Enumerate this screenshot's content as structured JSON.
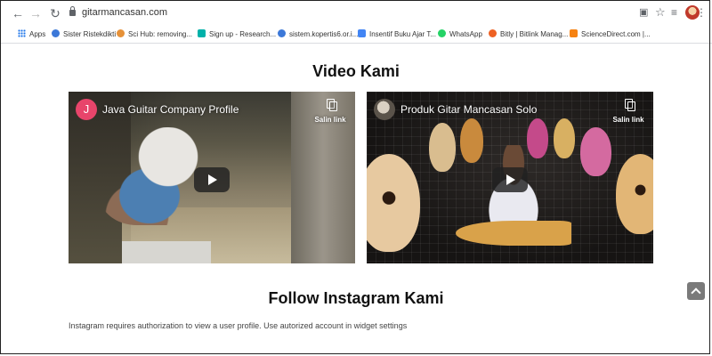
{
  "browser": {
    "url": "gitarmancasan.com",
    "icons": [
      "back-icon",
      "forward-icon",
      "reload-icon",
      "lock-icon",
      "star-icon",
      "kebab-icon"
    ]
  },
  "bookmarks": [
    {
      "label": "Apps",
      "icon": "apps-icon",
      "color": "#1a73e8"
    },
    {
      "label": "Sister Ristekdikti",
      "icon": "globe-icon",
      "color": "#3c78d8"
    },
    {
      "label": "Sci Hub: removing...",
      "icon": "scihub-icon",
      "color": "#e69138"
    },
    {
      "label": "Sign up - Research...",
      "icon": "researchgate-icon",
      "color": "#00b1a9"
    },
    {
      "label": "sistem.kopertis6.or.i...",
      "icon": "globe-icon",
      "color": "#3c78d8"
    },
    {
      "label": "Insentif Buku Ajar T...",
      "icon": "doc-icon",
      "color": "#4285f4"
    },
    {
      "label": "WhatsApp",
      "icon": "whatsapp-icon",
      "color": "#25d366"
    },
    {
      "label": "Bitly | Bitlink Manag...",
      "icon": "bitly-icon",
      "color": "#ee6123"
    },
    {
      "label": "ScienceDirect.com |...",
      "icon": "elsevier-icon",
      "color": "#f68212"
    }
  ],
  "video_section": {
    "title": "Video Kami",
    "videos": [
      {
        "avatar_letter": "J",
        "title": "Java Guitar Company Profile",
        "copy_label": "Salin link"
      },
      {
        "avatar_letter": "",
        "title": "Produk Gitar Mancasan Solo",
        "copy_label": "Salin link"
      }
    ]
  },
  "instagram_section": {
    "title": "Follow Instagram Kami",
    "message": "Instagram requires authorization to view a user profile. Use autorized account in widget settings"
  }
}
